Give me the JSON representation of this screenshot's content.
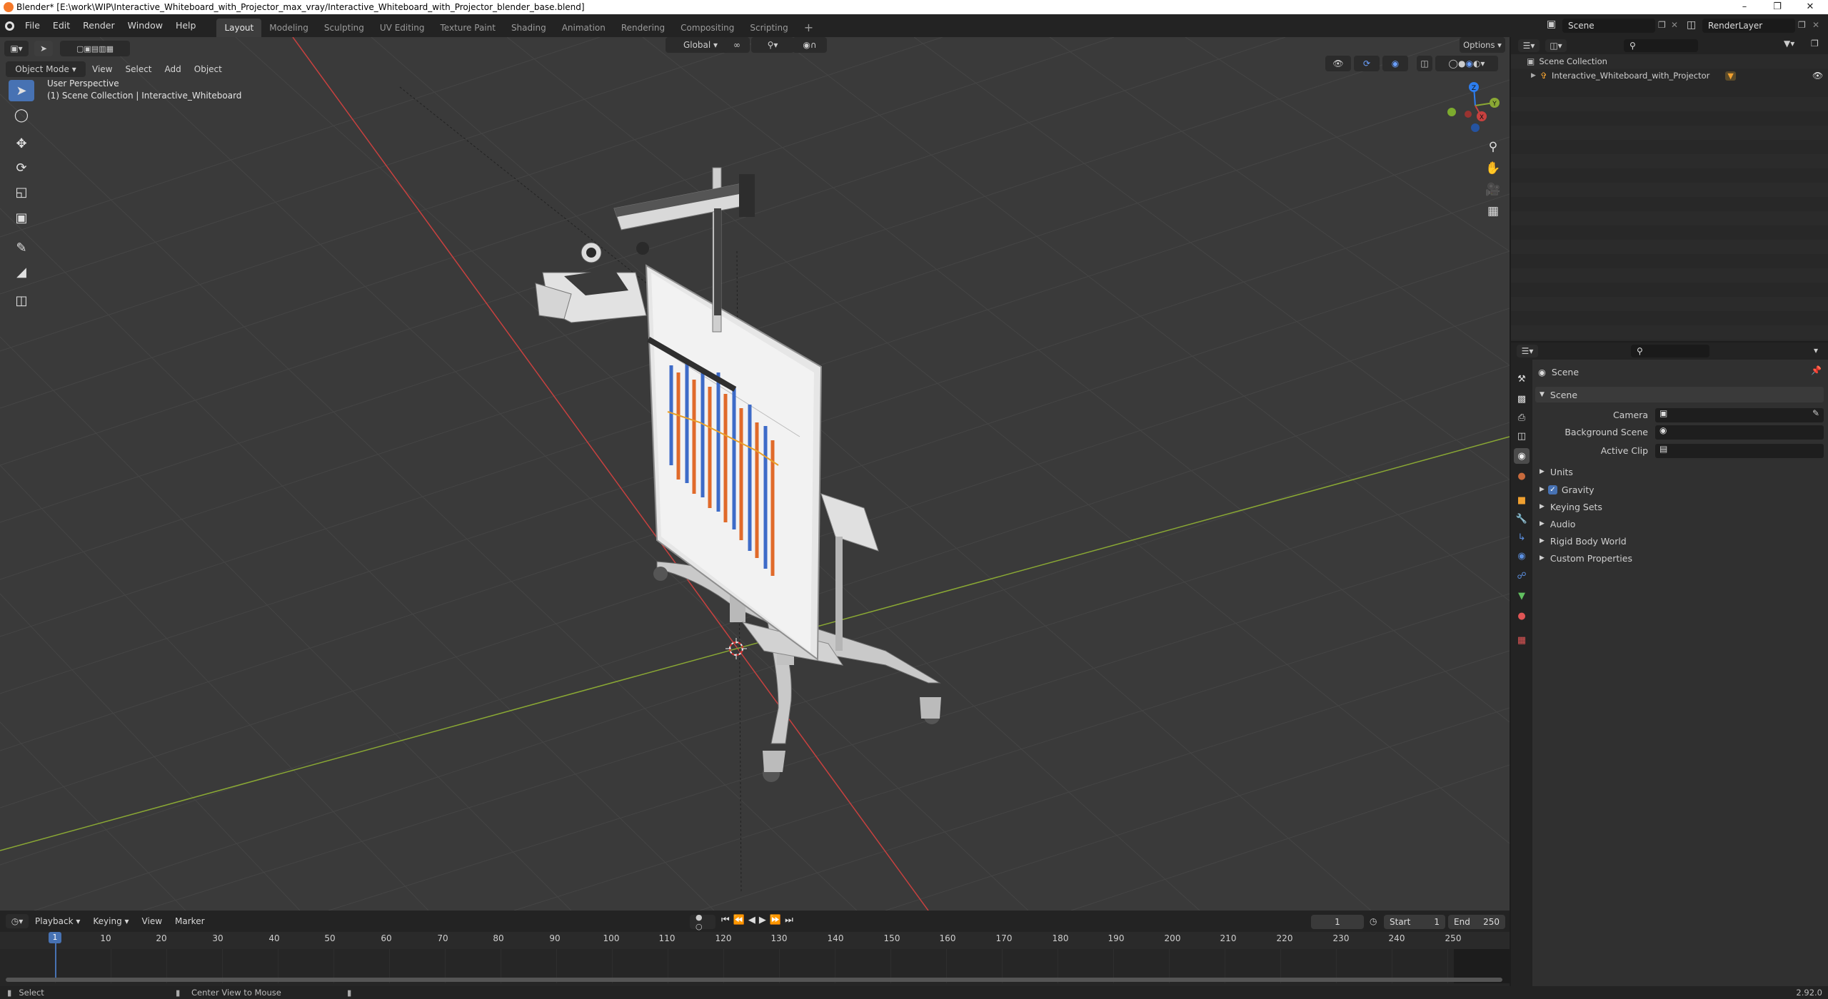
{
  "window": {
    "title": "Blender* [E:\\work\\WIP\\Interactive_Whiteboard_with_Projector_max_vray/Interactive_Whiteboard_with_Projector_blender_base.blend]"
  },
  "menu": [
    "File",
    "Edit",
    "Render",
    "Window",
    "Help"
  ],
  "workspaces": [
    "Layout",
    "Modeling",
    "Sculpting",
    "UV Editing",
    "Texture Paint",
    "Shading",
    "Animation",
    "Rendering",
    "Compositing",
    "Scripting"
  ],
  "workspace_add": "+",
  "scene_selector": "Scene",
  "view_layer": "RenderLayer",
  "viewport": {
    "mode": "Object Mode",
    "menus": [
      "View",
      "Select",
      "Add",
      "Object"
    ],
    "transform_orientation": "Global",
    "options": "Options",
    "overlay_title": "User Perspective",
    "overlay_subtitle": "(1) Scene Collection | Interactive_Whiteboard",
    "gizmo_axes": {
      "x": "X",
      "y": "Y",
      "z": "Z"
    }
  },
  "colors": {
    "x_axis": "#c8413f",
    "y_axis": "#8aa834",
    "z_axis": "#2d7ef0",
    "accent": "#4772b3",
    "active_frame": "#4772b3"
  },
  "outliner": {
    "root": "Scene Collection",
    "items": [
      {
        "label": "Interactive_Whiteboard_with_Projector"
      }
    ]
  },
  "properties": {
    "context_label": "Scene",
    "panel_title": "Scene",
    "fields": {
      "camera": "Camera",
      "background_scene": "Background Scene",
      "active_clip": "Active Clip"
    },
    "subpanels": [
      {
        "label": "Units",
        "checkbox": false
      },
      {
        "label": "Gravity",
        "checkbox": true
      },
      {
        "label": "Keying Sets",
        "checkbox": false
      },
      {
        "label": "Audio",
        "checkbox": false
      },
      {
        "label": "Rigid Body World",
        "checkbox": false
      },
      {
        "label": "Custom Properties",
        "checkbox": false
      }
    ]
  },
  "timeline": {
    "menus": [
      "Playback",
      "Keying",
      "View",
      "Marker"
    ],
    "current_frame": "1",
    "start_label": "Start",
    "start": "1",
    "end_label": "End",
    "end": "250",
    "ticks": [
      "10",
      "20",
      "30",
      "40",
      "50",
      "60",
      "70",
      "80",
      "90",
      "100",
      "110",
      "120",
      "130",
      "140",
      "150",
      "160",
      "170",
      "180",
      "190",
      "200",
      "210",
      "220",
      "230",
      "240",
      "250"
    ],
    "current_marker": "1"
  },
  "statusbar": {
    "left": "Select",
    "middle": "Center View to Mouse",
    "version": "2.92.0"
  }
}
